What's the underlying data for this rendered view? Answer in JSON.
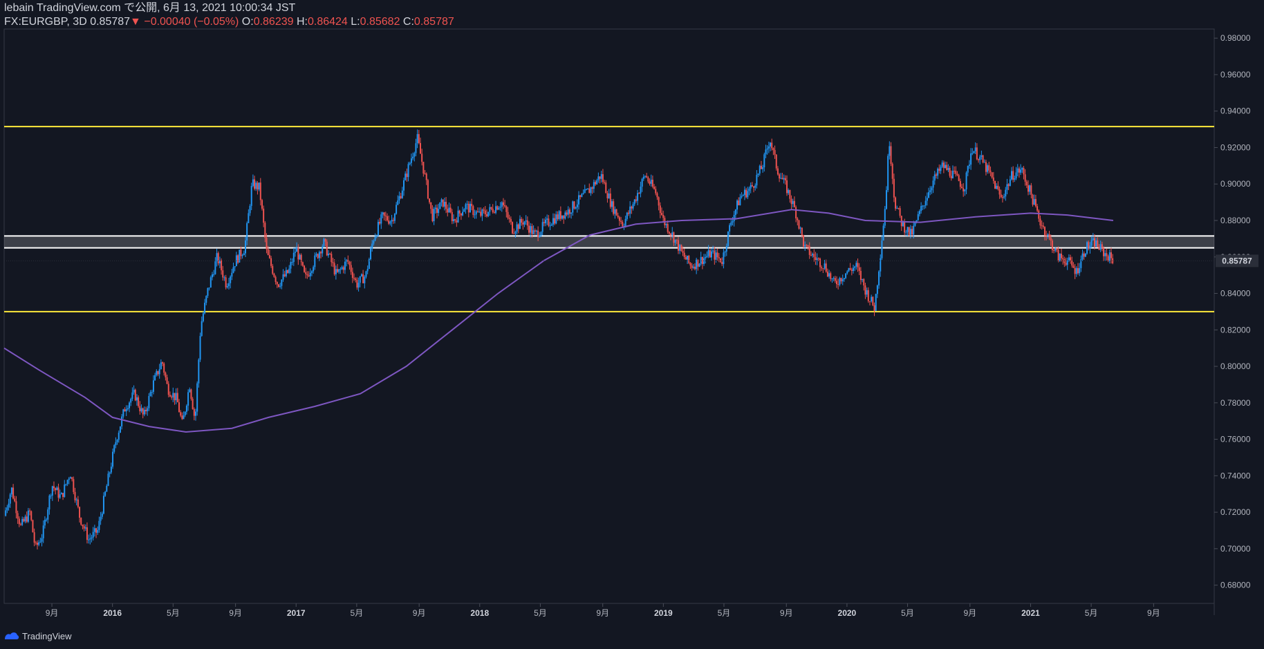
{
  "header": {
    "published_line": "lebain TradingView.com で公開, 6月 13, 2021 10:00:34 JST",
    "symbol": "FX:EURGBP, 3D",
    "last": "0.85787",
    "change": "−0.00040 (−0.05%)",
    "open_label": "O:",
    "open": "0.86239",
    "high_label": "H:",
    "high": "0.86424",
    "low_label": "L:",
    "low": "0.85682",
    "close_label": "C:",
    "close": "0.85787"
  },
  "footer": {
    "brand": "TradingView"
  },
  "colors": {
    "background": "#131722",
    "up": "#2196f3",
    "down": "#ef5350",
    "moving_average": "#7e57c2",
    "support_resistance": "#ffeb3b",
    "zone": "#ffffff",
    "price_tag_bg": "#2a2e39"
  },
  "chart_data": {
    "type": "line",
    "title": "",
    "ylim": [
      0.67,
      0.985
    ],
    "y_ticks": [
      "0.68000",
      "0.70000",
      "0.72000",
      "0.74000",
      "0.76000",
      "0.78000",
      "0.80000",
      "0.82000",
      "0.84000",
      "0.86000",
      "0.88000",
      "0.90000",
      "0.92000",
      "0.94000",
      "0.96000",
      "0.98000"
    ],
    "x_ticks": [
      {
        "t": 2015.67,
        "label": "9月"
      },
      {
        "t": 2016.0,
        "label": "2016",
        "bold": true
      },
      {
        "t": 2016.33,
        "label": "5月"
      },
      {
        "t": 2016.67,
        "label": "9月"
      },
      {
        "t": 2017.0,
        "label": "2017",
        "bold": true
      },
      {
        "t": 2017.33,
        "label": "5月"
      },
      {
        "t": 2017.67,
        "label": "9月"
      },
      {
        "t": 2018.0,
        "label": "2018",
        "bold": true
      },
      {
        "t": 2018.33,
        "label": "5月"
      },
      {
        "t": 2018.67,
        "label": "9月"
      },
      {
        "t": 2019.0,
        "label": "2019",
        "bold": true
      },
      {
        "t": 2019.33,
        "label": "5月"
      },
      {
        "t": 2019.67,
        "label": "9月"
      },
      {
        "t": 2020.0,
        "label": "2020",
        "bold": true
      },
      {
        "t": 2020.33,
        "label": "5月"
      },
      {
        "t": 2020.67,
        "label": "9月"
      },
      {
        "t": 2021.0,
        "label": "2021",
        "bold": true
      },
      {
        "t": 2021.33,
        "label": "5月"
      },
      {
        "t": 2021.67,
        "label": "9月"
      }
    ],
    "xlim": [
      2015.41,
      2022.0
    ],
    "last_price_label": "0.85787",
    "horizontal_lines": [
      {
        "name": "resistance",
        "value": 0.9315,
        "color": "#ffeb3b"
      },
      {
        "name": "support",
        "value": 0.83,
        "color": "#ffeb3b"
      }
    ],
    "zone": {
      "top": 0.8715,
      "bottom": 0.865
    },
    "price_path": [
      [
        2015.41,
        0.718
      ],
      [
        2015.45,
        0.733
      ],
      [
        2015.5,
        0.712
      ],
      [
        2015.55,
        0.72
      ],
      [
        2015.58,
        0.7
      ],
      [
        2015.62,
        0.708
      ],
      [
        2015.67,
        0.735
      ],
      [
        2015.72,
        0.728
      ],
      [
        2015.77,
        0.742
      ],
      [
        2015.82,
        0.718
      ],
      [
        2015.87,
        0.705
      ],
      [
        2015.92,
        0.71
      ],
      [
        2015.97,
        0.735
      ],
      [
        2016.02,
        0.76
      ],
      [
        2016.07,
        0.778
      ],
      [
        2016.12,
        0.785
      ],
      [
        2016.17,
        0.772
      ],
      [
        2016.22,
        0.79
      ],
      [
        2016.27,
        0.803
      ],
      [
        2016.3,
        0.788
      ],
      [
        2016.35,
        0.782
      ],
      [
        2016.38,
        0.768
      ],
      [
        2016.42,
        0.79
      ],
      [
        2016.45,
        0.77
      ],
      [
        2016.48,
        0.822
      ],
      [
        2016.52,
        0.842
      ],
      [
        2016.57,
        0.86
      ],
      [
        2016.62,
        0.845
      ],
      [
        2016.67,
        0.858
      ],
      [
        2016.72,
        0.865
      ],
      [
        2016.76,
        0.9
      ],
      [
        2016.8,
        0.898
      ],
      [
        2016.84,
        0.862
      ],
      [
        2016.9,
        0.845
      ],
      [
        2016.96,
        0.852
      ],
      [
        2017.0,
        0.865
      ],
      [
        2017.05,
        0.848
      ],
      [
        2017.1,
        0.858
      ],
      [
        2017.15,
        0.868
      ],
      [
        2017.22,
        0.85
      ],
      [
        2017.28,
        0.858
      ],
      [
        2017.33,
        0.845
      ],
      [
        2017.38,
        0.85
      ],
      [
        2017.42,
        0.87
      ],
      [
        2017.47,
        0.882
      ],
      [
        2017.52,
        0.88
      ],
      [
        2017.57,
        0.895
      ],
      [
        2017.62,
        0.912
      ],
      [
        2017.66,
        0.925
      ],
      [
        2017.7,
        0.905
      ],
      [
        2017.74,
        0.882
      ],
      [
        2017.8,
        0.89
      ],
      [
        2017.86,
        0.88
      ],
      [
        2017.92,
        0.888
      ],
      [
        2018.0,
        0.883
      ],
      [
        2018.05,
        0.885
      ],
      [
        2018.12,
        0.89
      ],
      [
        2018.18,
        0.875
      ],
      [
        2018.24,
        0.88
      ],
      [
        2018.3,
        0.872
      ],
      [
        2018.36,
        0.878
      ],
      [
        2018.42,
        0.882
      ],
      [
        2018.48,
        0.885
      ],
      [
        2018.55,
        0.892
      ],
      [
        2018.6,
        0.897
      ],
      [
        2018.66,
        0.905
      ],
      [
        2018.72,
        0.888
      ],
      [
        2018.78,
        0.878
      ],
      [
        2018.84,
        0.89
      ],
      [
        2018.9,
        0.905
      ],
      [
        2018.96,
        0.895
      ],
      [
        2019.0,
        0.88
      ],
      [
        2019.05,
        0.872
      ],
      [
        2019.1,
        0.862
      ],
      [
        2019.15,
        0.855
      ],
      [
        2019.2,
        0.858
      ],
      [
        2019.26,
        0.862
      ],
      [
        2019.32,
        0.858
      ],
      [
        2019.37,
        0.88
      ],
      [
        2019.42,
        0.893
      ],
      [
        2019.48,
        0.898
      ],
      [
        2019.54,
        0.91
      ],
      [
        2019.58,
        0.925
      ],
      [
        2019.62,
        0.908
      ],
      [
        2019.67,
        0.898
      ],
      [
        2019.72,
        0.885
      ],
      [
        2019.77,
        0.865
      ],
      [
        2019.82,
        0.86
      ],
      [
        2019.88,
        0.855
      ],
      [
        2019.93,
        0.845
      ],
      [
        2020.0,
        0.852
      ],
      [
        2020.05,
        0.855
      ],
      [
        2020.1,
        0.842
      ],
      [
        2020.15,
        0.832
      ],
      [
        2020.18,
        0.86
      ],
      [
        2020.21,
        0.89
      ],
      [
        2020.23,
        0.925
      ],
      [
        2020.26,
        0.89
      ],
      [
        2020.3,
        0.878
      ],
      [
        2020.35,
        0.872
      ],
      [
        2020.4,
        0.885
      ],
      [
        2020.46,
        0.9
      ],
      [
        2020.52,
        0.91
      ],
      [
        2020.58,
        0.905
      ],
      [
        2020.64,
        0.898
      ],
      [
        2020.68,
        0.92
      ],
      [
        2020.72,
        0.915
      ],
      [
        2020.78,
        0.905
      ],
      [
        2020.84,
        0.892
      ],
      [
        2020.9,
        0.905
      ],
      [
        2020.95,
        0.908
      ],
      [
        2021.0,
        0.895
      ],
      [
        2021.05,
        0.88
      ],
      [
        2021.1,
        0.87
      ],
      [
        2021.15,
        0.86
      ],
      [
        2021.2,
        0.858
      ],
      [
        2021.25,
        0.852
      ],
      [
        2021.3,
        0.865
      ],
      [
        2021.35,
        0.868
      ],
      [
        2021.4,
        0.862
      ],
      [
        2021.45,
        0.8585
      ]
    ],
    "moving_average": [
      [
        2015.41,
        0.81
      ],
      [
        2015.6,
        0.798
      ],
      [
        2015.85,
        0.783
      ],
      [
        2016.0,
        0.772
      ],
      [
        2016.2,
        0.767
      ],
      [
        2016.4,
        0.764
      ],
      [
        2016.65,
        0.766
      ],
      [
        2016.85,
        0.772
      ],
      [
        2017.1,
        0.778
      ],
      [
        2017.35,
        0.785
      ],
      [
        2017.6,
        0.8
      ],
      [
        2017.85,
        0.82
      ],
      [
        2018.1,
        0.84
      ],
      [
        2018.35,
        0.858
      ],
      [
        2018.6,
        0.872
      ],
      [
        2018.85,
        0.878
      ],
      [
        2019.1,
        0.88
      ],
      [
        2019.4,
        0.881
      ],
      [
        2019.7,
        0.886
      ],
      [
        2019.9,
        0.884
      ],
      [
        2020.1,
        0.88
      ],
      [
        2020.4,
        0.879
      ],
      [
        2020.7,
        0.882
      ],
      [
        2021.0,
        0.884
      ],
      [
        2021.2,
        0.883
      ],
      [
        2021.45,
        0.88
      ]
    ]
  }
}
